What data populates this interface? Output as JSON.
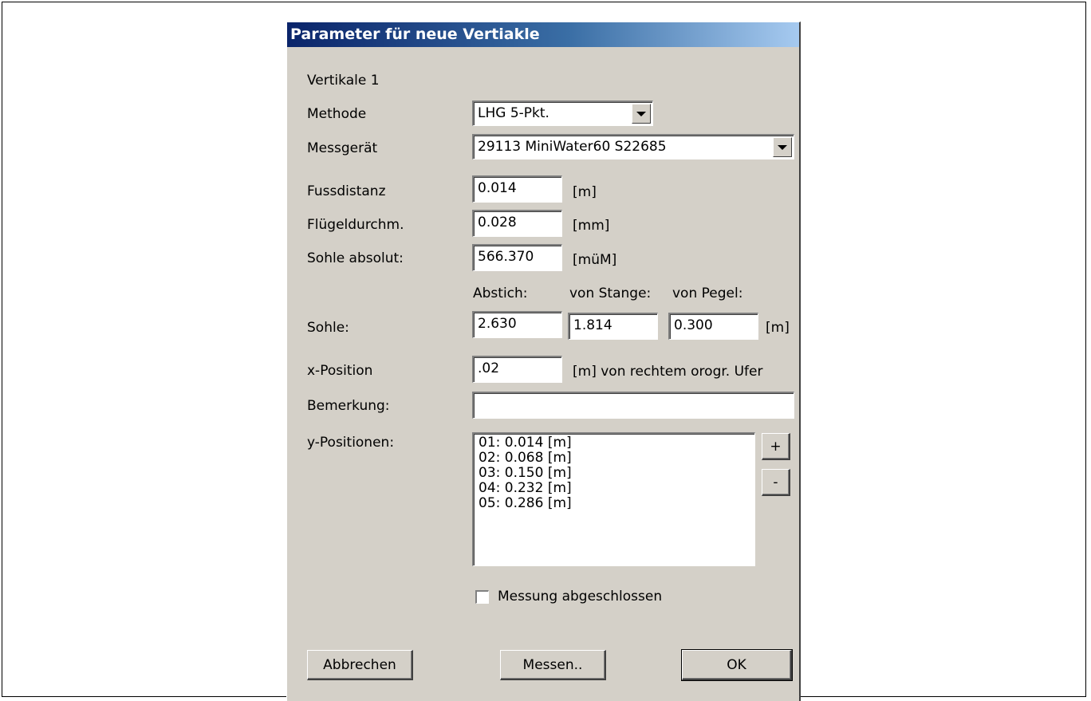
{
  "dialog": {
    "title": "Parameter für neue Vertiakle",
    "subtitle": "Vertikale 1"
  },
  "form": {
    "methode": {
      "label": "Methode",
      "value": "LHG 5-Pkt."
    },
    "messgeraet": {
      "label": "Messgerät",
      "value": "29113 MiniWater60  S22685"
    },
    "fussdistanz": {
      "label": "Fussdistanz",
      "value": "0.014",
      "unit": "[m]"
    },
    "fluegeldurchm": {
      "label": "Flügeldurchm.",
      "value": "0.028",
      "unit": "[mm]"
    },
    "sohle_absolut": {
      "label": "Sohle absolut:",
      "value": "566.370",
      "unit": "[müM]"
    },
    "sohle": {
      "label": "Sohle:",
      "abstich_label": "Abstich:",
      "von_stange_label": "von Stange:",
      "von_pegel_label": "von Pegel:",
      "abstich_value": "2.630",
      "von_stange_value": "1.814",
      "von_pegel_value": "0.300",
      "unit": "[m]"
    },
    "x_position": {
      "label": "x-Position",
      "value": ".02",
      "unit": "[m] von rechtem orogr. Ufer"
    },
    "bemerkung": {
      "label": "Bemerkung:",
      "value": ""
    },
    "y_positionen": {
      "label": "y-Positionen:",
      "items": [
        "01: 0.014 [m]",
        "02: 0.068 [m]",
        "03: 0.150 [m]",
        "04: 0.232 [m]",
        "05: 0.286 [m]"
      ],
      "add_label": "+",
      "remove_label": "-"
    },
    "messung_abgeschlossen": {
      "label": "Messung abgeschlossen",
      "checked": false
    }
  },
  "buttons": {
    "abbrechen": "Abbrechen",
    "messen": "Messen..",
    "ok": "OK"
  }
}
